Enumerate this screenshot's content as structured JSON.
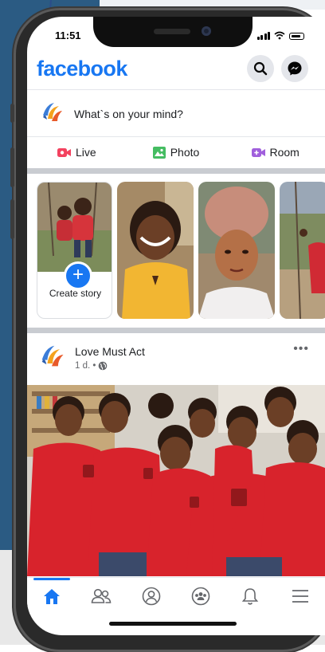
{
  "status_bar": {
    "time": "11:51"
  },
  "header": {
    "logo_text": "facebook"
  },
  "composer": {
    "placeholder": "What`s on your mind?"
  },
  "actions": [
    {
      "label": "Live",
      "icon": "live-video-icon",
      "color": "#f3425f"
    },
    {
      "label": "Photo",
      "icon": "photo-icon",
      "color": "#45bd62"
    },
    {
      "label": "Room",
      "icon": "room-video-icon",
      "color": "#a05fdc"
    }
  ],
  "stories": {
    "create_label": "Create story"
  },
  "post": {
    "author": "Love Must Act",
    "meta": "1 d. •"
  },
  "tabbar": {
    "tabs": [
      {
        "name": "home-icon",
        "active": true
      },
      {
        "name": "friends-icon",
        "active": false
      },
      {
        "name": "profile-icon",
        "active": false
      },
      {
        "name": "groups-icon",
        "active": false
      },
      {
        "name": "bell-icon",
        "active": false
      },
      {
        "name": "menu-icon",
        "active": false
      }
    ]
  },
  "colors": {
    "brand": "#1877f2",
    "background_left": "#2b5b83",
    "divider": "#c9ccd1"
  }
}
